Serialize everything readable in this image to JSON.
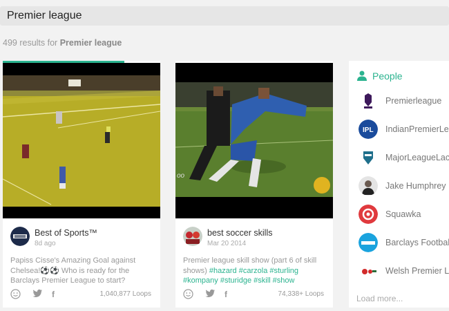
{
  "search": {
    "value": "Premier league"
  },
  "results": {
    "count_text": "499 results for",
    "query": "Premier league"
  },
  "cards": [
    {
      "title": "Best of Sports™",
      "date": "8d ago",
      "description": "Papiss Cisse's Amazing Goal against Chelsea!⚽⚽ Who is ready for the Barclays Premier League to start?",
      "loops": "1,040,877 Loops",
      "progress": 0.77
    },
    {
      "title": "best soccer skills",
      "date": "Mar 20 2014",
      "description_prefix": "Premier league skill show (part 6 of skill shows)",
      "tags": [
        "#hazard",
        "#carzola",
        "#sturling",
        "#kompany",
        "#sturidge",
        "#skill",
        "#show"
      ],
      "loops": "74,338+ Loops",
      "progress": 0
    }
  ],
  "people": {
    "title": "People",
    "items": [
      {
        "name": "Premierleague"
      },
      {
        "name": "IndianPremierLe"
      },
      {
        "name": "MajorLeagueLac"
      },
      {
        "name": "Jake Humphrey"
      },
      {
        "name": "Squawka"
      },
      {
        "name": "Barclays Footbal"
      },
      {
        "name": "Welsh Premier L"
      }
    ],
    "load_more": "Load more..."
  },
  "colors": {
    "accent": "#2bb38f",
    "background": "#f2f2f2"
  }
}
